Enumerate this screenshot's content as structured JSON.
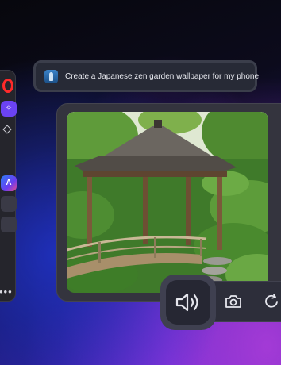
{
  "prompt": {
    "text": "Create a Japanese zen garden  wallpaper for my phone",
    "avatar_icon": "user-avatar-icon"
  },
  "sidebar": {
    "icons": [
      "opera-logo-icon",
      "aria-ai-icon",
      "diamond-icon",
      "app-store-icon",
      "more-icon"
    ],
    "aria_glyph": "✧",
    "app_glyph": "A",
    "more_glyph": "•••"
  },
  "image": {
    "subject": "zen-garden-pavilion-image"
  },
  "toolbar": {
    "actions": [
      "speaker-icon",
      "camera-icon",
      "refresh-icon"
    ]
  },
  "colors": {
    "accent": "#6b43f3",
    "opera_red": "#ff2a2a",
    "panel": "#272a36"
  }
}
